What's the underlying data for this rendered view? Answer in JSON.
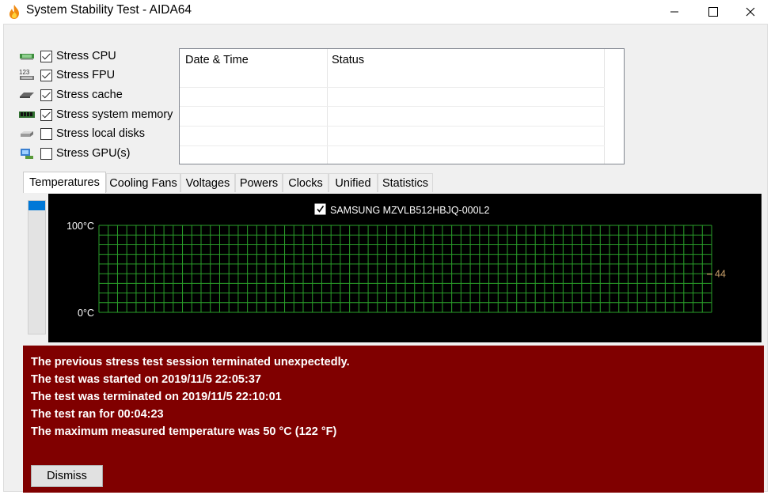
{
  "window": {
    "title": "System Stability Test - AIDA64"
  },
  "stress_options": [
    {
      "label": "Stress CPU",
      "checked": true,
      "icon": "cpu-icon"
    },
    {
      "label": "Stress FPU",
      "checked": true,
      "icon": "fpu-icon"
    },
    {
      "label": "Stress cache",
      "checked": true,
      "icon": "cache-icon"
    },
    {
      "label": "Stress system memory",
      "checked": true,
      "icon": "memory-icon"
    },
    {
      "label": "Stress local disks",
      "checked": false,
      "icon": "disk-icon"
    },
    {
      "label": "Stress GPU(s)",
      "checked": false,
      "icon": "gpu-icon"
    }
  ],
  "log_table": {
    "columns": [
      "Date & Time",
      "Status"
    ],
    "rows": []
  },
  "tabs": [
    {
      "label": "Temperatures",
      "active": true
    },
    {
      "label": "Cooling Fans",
      "active": false
    },
    {
      "label": "Voltages",
      "active": false
    },
    {
      "label": "Powers",
      "active": false
    },
    {
      "label": "Clocks",
      "active": false
    },
    {
      "label": "Unified",
      "active": false
    },
    {
      "label": "Statistics",
      "active": false
    }
  ],
  "chart_data": {
    "type": "line",
    "series": [
      {
        "name": "SAMSUNG MZVLB512HBJQ-000L2",
        "checked": true,
        "current_value": 44,
        "values": [],
        "color": "#c8a06a"
      }
    ],
    "ylim": [
      0,
      100
    ],
    "y_tick_labels": [
      "100°C",
      "0°C"
    ],
    "grid": true,
    "grid_color": "#2aa02a",
    "background": "#000000",
    "value_marker_label": "44"
  },
  "alert": {
    "background": "#800000",
    "lines": [
      "The previous stress test session terminated unexpectedly.",
      "The test was started on 2019/11/5 22:05:37",
      "The test was terminated on 2019/11/5 22:10:01",
      "The test ran for 00:04:23",
      "The maximum measured temperature was 50 °C  (122 °F)"
    ],
    "dismiss_label": "Dismiss"
  }
}
